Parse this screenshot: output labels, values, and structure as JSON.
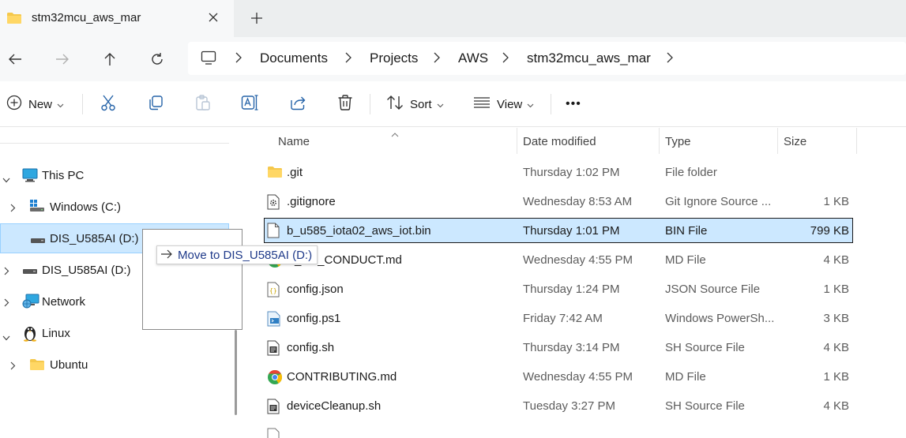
{
  "tab": {
    "title": "stm32mcu_aws_mar",
    "icon": "folder-icon",
    "close_icon": "close-icon",
    "new_tab_icon": "plus-icon"
  },
  "nav": {
    "back_icon": "back-arrow-icon",
    "forward_icon": "forward-arrow-icon",
    "up_icon": "up-arrow-icon",
    "refresh_icon": "refresh-icon",
    "breadcrumb": [
      "Documents",
      "Projects",
      "AWS",
      "stm32mcu_aws_mar"
    ]
  },
  "toolbar": {
    "new_label": "New",
    "sort_label": "Sort",
    "view_label": "View",
    "more_label": "•••",
    "icons": [
      "cut-icon",
      "copy-icon",
      "paste-icon",
      "rename-icon",
      "share-icon",
      "delete-icon"
    ]
  },
  "sidebar": {
    "items": [
      {
        "label": "This PC",
        "icon": "computer-icon",
        "expanded": true
      },
      {
        "label": "Windows (C:)",
        "icon": "drive-icon",
        "expanded": false
      },
      {
        "label": "DIS_U585AI (D:)",
        "icon": "usb-drive-icon",
        "selected": true
      },
      {
        "label": "DIS_U585AI (D:)",
        "icon": "usb-drive-icon",
        "expanded": false
      },
      {
        "label": "Network",
        "icon": "network-icon",
        "expanded": false
      },
      {
        "label": "Linux",
        "icon": "linux-penguin-icon",
        "expanded": true
      },
      {
        "label": "Ubuntu",
        "icon": "folder-icon",
        "expanded": false
      }
    ]
  },
  "drag": {
    "tooltip": "Move to DIS_U585AI (D:)",
    "icon": "arrow-right-icon"
  },
  "columns": {
    "name": "Name",
    "date": "Date modified",
    "type": "Type",
    "size": "Size"
  },
  "files": [
    {
      "name": ".git",
      "date": "Thursday 1:02 PM",
      "type": "File folder",
      "size": "",
      "icon": "folder-icon"
    },
    {
      "name": ".gitignore",
      "date": "Wednesday 8:53 AM",
      "type": "Git Ignore Source ...",
      "size": "1 KB",
      "icon": "settings-file-icon"
    },
    {
      "name": "b_u585_iota02_aws_iot.bin",
      "date": "Thursday 1:01 PM",
      "type": "BIN File",
      "size": "799 KB",
      "icon": "blank-file-icon",
      "selected": true
    },
    {
      "name": "E_OF_CONDUCT.md",
      "date": "Wednesday 4:55 PM",
      "type": "MD File",
      "size": "4 KB",
      "icon": "chrome-icon"
    },
    {
      "name": "config.json",
      "date": "Thursday 1:24 PM",
      "type": "JSON Source File",
      "size": "1 KB",
      "icon": "json-file-icon"
    },
    {
      "name": "config.ps1",
      "date": "Friday 7:42 AM",
      "type": "Windows PowerSh...",
      "size": "3 KB",
      "icon": "powershell-file-icon"
    },
    {
      "name": "config.sh",
      "date": "Thursday 3:14 PM",
      "type": "SH Source File",
      "size": "4 KB",
      "icon": "script-file-icon"
    },
    {
      "name": "CONTRIBUTING.md",
      "date": "Wednesday 4:55 PM",
      "type": "MD File",
      "size": "1 KB",
      "icon": "chrome-icon"
    },
    {
      "name": "deviceCleanup.sh",
      "date": "Tuesday 3:27 PM",
      "type": "SH Source File",
      "size": "4 KB",
      "icon": "script-file-icon"
    }
  ],
  "colors": {
    "selection_bg": "#cce8ff",
    "selection_border": "#99d1ff",
    "folder_yellow": "#f5c84c",
    "link_blue": "#1f3a8a"
  }
}
